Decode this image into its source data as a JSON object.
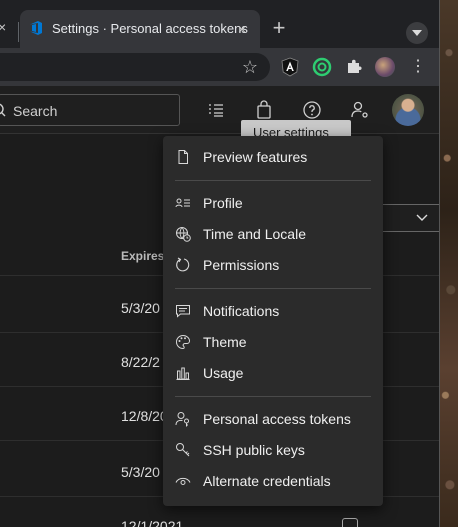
{
  "browser": {
    "active_tab_title": "Settings · Personal access tokens",
    "prev_tab_close": "×",
    "tab_close": "×",
    "new_tab": "+",
    "menu_glyph": "⋮",
    "bookmark_glyph": "☆"
  },
  "header": {
    "search_placeholder": "Search",
    "tooltip_text": "User settings"
  },
  "table": {
    "column_header": "Expires",
    "expires": [
      "5/3/20",
      "8/22/2",
      "12/8/20",
      "5/3/20",
      "12/1/2021"
    ]
  },
  "menu": {
    "items": [
      {
        "label": "Preview features",
        "icon": "document-icon"
      },
      {
        "label": "Profile",
        "icon": "profile-card-icon"
      },
      {
        "label": "Time and Locale",
        "icon": "globe-clock-icon"
      },
      {
        "label": "Permissions",
        "icon": "circular-arrow-icon"
      },
      {
        "label": "Notifications",
        "icon": "chat-icon"
      },
      {
        "label": "Theme",
        "icon": "palette-icon"
      },
      {
        "label": "Usage",
        "icon": "bar-chart-icon"
      },
      {
        "label": "Personal access tokens",
        "icon": "person-key-icon"
      },
      {
        "label": "SSH public keys",
        "icon": "key-icon"
      },
      {
        "label": "Alternate credentials",
        "icon": "eye-icon"
      }
    ]
  },
  "colors": {
    "tab_bg": "#35363a",
    "strip_bg": "#202124",
    "menu_bg": "#2b2b2b",
    "azure_blue": "#0078d4"
  }
}
